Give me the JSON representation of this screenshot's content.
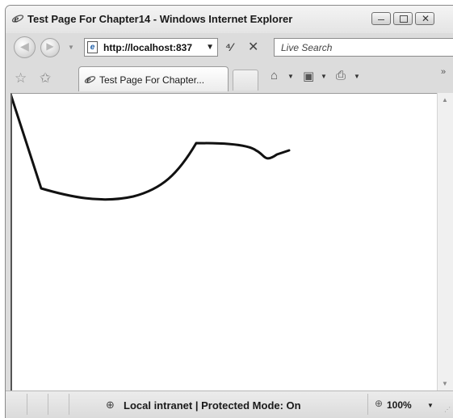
{
  "window": {
    "title": "Test Page For Chapter14 - Windows Internet Explorer"
  },
  "address_bar": {
    "url": "http://localhost:837",
    "search_placeholder": "Live Search"
  },
  "tabs": [
    {
      "label": "Test Page For Chapter..."
    }
  ],
  "status_bar": {
    "zone": "Local intranet | Protected Mode: On",
    "zoom": "100%"
  },
  "drawing": {
    "stroke_color": "#111111"
  },
  "icons": {
    "title": "ie-logo-icon",
    "back": "back-arrow-icon",
    "forward": "forward-arrow-icon",
    "page": "page-icon",
    "refresh": "refresh-icon",
    "stop": "stop-icon",
    "favorites": "favorites-star-icon",
    "add_favorites": "add-favorites-icon",
    "home": "home-icon",
    "feeds": "feeds-icon",
    "print": "print-icon",
    "zone": "network-zone-icon",
    "zoom": "zoom-icon"
  }
}
